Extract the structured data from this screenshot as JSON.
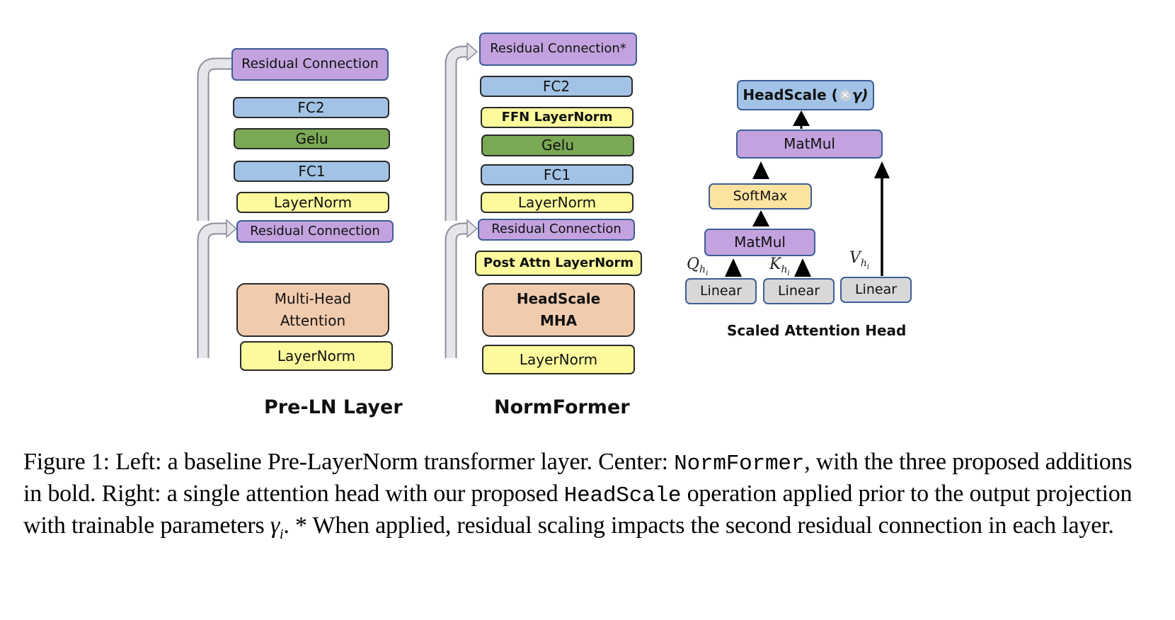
{
  "figure": {
    "pre_ln": {
      "title": "Pre-LN Layer",
      "blocks": {
        "residual_top": "Residual Connection",
        "fc2": "FC2",
        "gelu": "Gelu",
        "fc1": "FC1",
        "layernorm_ffn": "LayerNorm",
        "residual_mid": "Residual Connection",
        "mha_line1": "Multi-Head",
        "mha_line2": "Attention",
        "layernorm_attn": "LayerNorm"
      }
    },
    "normformer": {
      "title": "NormFormer",
      "blocks": {
        "residual_top": "Residual Connection*",
        "fc2": "FC2",
        "ffn_layernorm": "FFN LayerNorm",
        "gelu": "Gelu",
        "fc1": "FC1",
        "layernorm_ffn": "LayerNorm",
        "residual_mid": "Residual Connection",
        "post_attn_layernorm": "Post Attn LayerNorm",
        "mha_line1": "HeadScale",
        "mha_line2": "MHA",
        "layernorm_attn": "LayerNorm"
      }
    },
    "attention_head": {
      "title": "Scaled Attention Head",
      "blocks": {
        "headscale": "HeadScale (",
        "headscale_gamma": "γ)",
        "matmul_top": "MatMul",
        "softmax": "SoftMax",
        "matmul_bottom": "MatMul",
        "linear_q": "Linear",
        "linear_k": "Linear",
        "linear_v": "Linear"
      },
      "inputs": {
        "q": "Q",
        "k": "K",
        "v": "V",
        "sub": "h",
        "subsub": "i"
      }
    }
  },
  "caption": {
    "part1": "Figure 1: Left: a baseline Pre-LayerNorm transformer layer. Center: ",
    "code1": "NormFormer",
    "part2": ", with the three proposed additions in bold. Right: a single attention head with our proposed ",
    "code2": "HeadScale",
    "part3": " operation applied prior to the output projection with trainable parameters ",
    "gamma": "γ",
    "gamma_sub": "i",
    "part4": ". * When applied, residual scaling impacts the second residual connection in each layer."
  },
  "colors": {
    "residual": "#c3a3df",
    "fc": "#a3c3e6",
    "gelu": "#7ba854",
    "layernorm": "#fdfa9d",
    "attention": "#f1cbae",
    "softmax": "#fce3a0",
    "linear": "#d8d8d8",
    "border_blue": "#3e5e96",
    "skip_arrow": "#e6e6ea"
  }
}
